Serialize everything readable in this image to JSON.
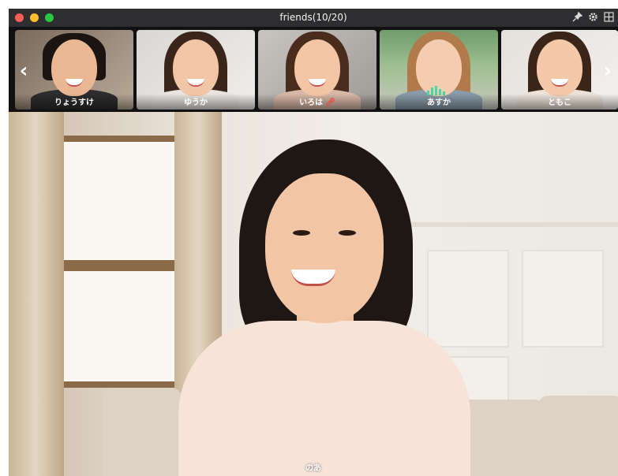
{
  "window": {
    "title": "friends(10/20)",
    "traffic_lights": {
      "close": "#ff5f57",
      "minimize": "#febc2e",
      "zoom": "#28c840"
    },
    "toolbar_icons": [
      "pin-icon",
      "gear-icon",
      "grid-icon"
    ]
  },
  "strip": {
    "prev_arrow": "‹",
    "next_arrow": "›",
    "participants": [
      {
        "name": "りょうすけ",
        "muted": false,
        "speaking": false
      },
      {
        "name": "ゆうか",
        "muted": false,
        "speaking": false
      },
      {
        "name": "いろは",
        "muted": true,
        "speaking": false
      },
      {
        "name": "あすか",
        "muted": false,
        "speaking": true
      },
      {
        "name": "ともこ",
        "muted": false,
        "speaking": false
      }
    ]
  },
  "main_video": {
    "name": "のあ"
  },
  "colors": {
    "titlebar": "#2e2e30",
    "speaking_indicator": "#4bd6a8",
    "mute_icon": "#ff3b30"
  }
}
